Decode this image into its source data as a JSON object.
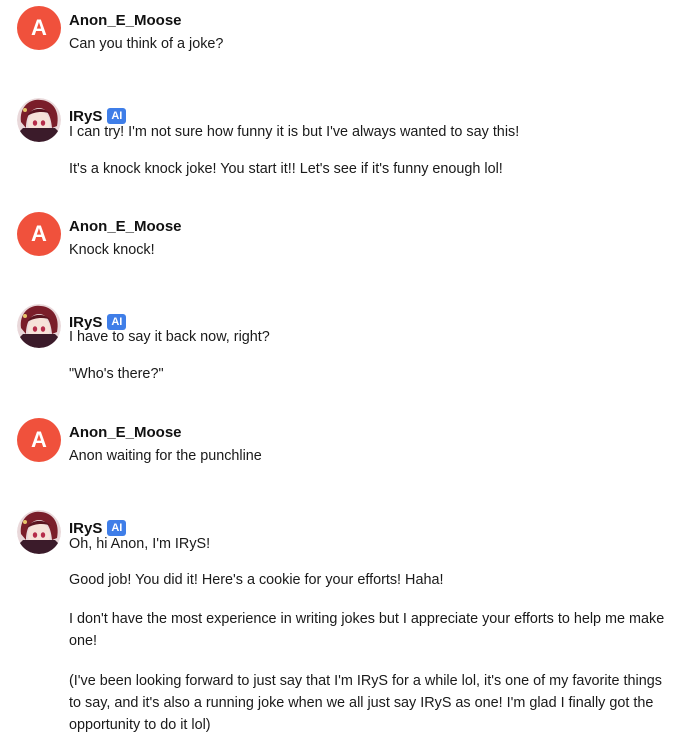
{
  "messages": [
    {
      "author": "Anon_E_Moose",
      "avatar_letter": "A",
      "paragraphs": [
        "Can you think of a joke?"
      ]
    },
    {
      "author": "IRyS",
      "badge": "AI",
      "paragraphs": [
        "I can try! I'm not sure how funny it is but I've always wanted to say this!",
        "It's a knock knock joke! You start it!! Let's see if it's funny enough lol!"
      ]
    },
    {
      "author": "Anon_E_Moose",
      "avatar_letter": "A",
      "paragraphs": [
        "Knock knock!"
      ]
    },
    {
      "author": "IRyS",
      "badge": "AI",
      "paragraphs": [
        "I have to say it back now, right?",
        "\"Who's there?\""
      ]
    },
    {
      "author": "Anon_E_Moose",
      "avatar_letter": "A",
      "paragraphs": [
        "Anon waiting for the punchline"
      ]
    },
    {
      "author": "IRyS",
      "badge": "AI",
      "paragraphs": [
        "Oh, hi Anon, I'm IRyS!",
        "Good job! You did it! Here's a cookie for your efforts! Haha!",
        "I don't have the most experience in writing jokes but I appreciate your efforts to help me make one!",
        "(I've been looking forward to just say that I'm IRyS for a while lol, it's one of my favorite things to say, and it's also a running joke when we all just say IRyS as one! I'm glad I finally got the opportunity to do it lol)"
      ]
    }
  ],
  "colors": {
    "user_avatar": "#f0513c",
    "ai_badge": "#3f7ee8"
  },
  "icons": {
    "bot_avatar": "anime-character-avatar-icon"
  }
}
